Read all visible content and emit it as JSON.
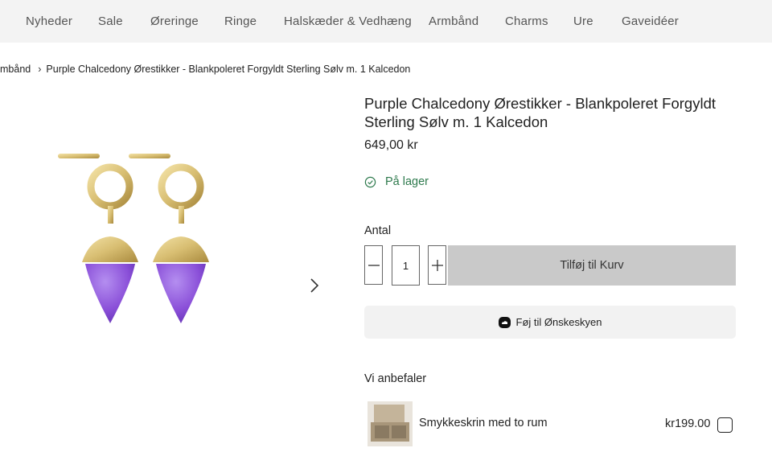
{
  "nav": {
    "items": [
      "Nyheder",
      "Sale",
      "Øreringe",
      "Ringe",
      "Halskæder & Vedhæng",
      "Armbånd",
      "Charms",
      "Ure",
      "Gaveidéer"
    ]
  },
  "breadcrumb": {
    "parent": "mbånd",
    "current": "Purple Chalcedony Ørestikker - Blankpoleret Forgyldt Sterling Sølv m. 1 Kalcedon"
  },
  "product": {
    "title": "Purple Chalcedony Ørestikker - Blankpoleret Forgyldt Sterling Sølv m. 1 Kalcedon",
    "price": "649,00 kr",
    "stock": "På lager",
    "quantity_label": "Antal",
    "quantity": "1",
    "add_to_cart": "Tilføj til Kurv",
    "wishlist": "Føj til Ønskeskyen"
  },
  "recommend": {
    "heading": "Vi anbefaler",
    "item": {
      "name": "Smykkeskrin med to rum",
      "price": "kr199.00"
    }
  },
  "colors": {
    "nav_bg": "#f3f3f3",
    "in_stock": "#2e7a4d",
    "add_button_bg": "#c9c9c9",
    "stone": "#8a4fd8",
    "gold": "#d8be72"
  },
  "icons": {
    "stock": "check-circle-icon",
    "minus": "minus-icon",
    "plus": "plus-icon",
    "next": "chevron-right-icon",
    "wishlist": "cloud-icon"
  }
}
